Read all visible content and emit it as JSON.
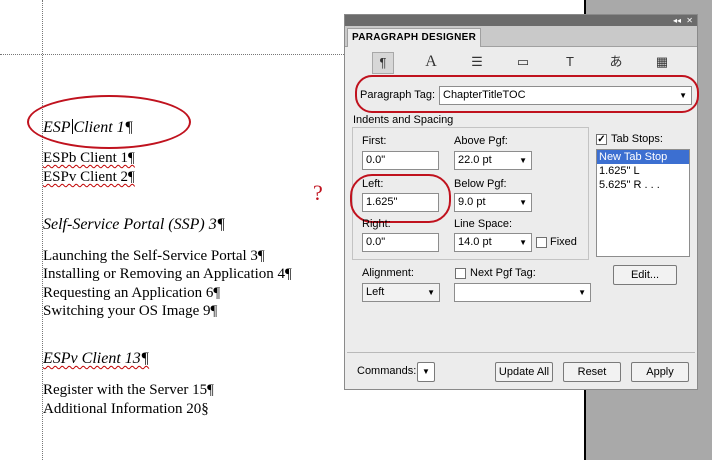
{
  "document": {
    "lines": [
      {
        "type": "heading",
        "parts": [
          "ESP",
          "Client 1¶"
        ]
      },
      {
        "type": "body",
        "text": "ESPb Client 1¶"
      },
      {
        "type": "body",
        "text": "ESPv Client 2¶"
      },
      {
        "type": "heading",
        "text": "Self-Service Portal (SSP) 3¶"
      },
      {
        "type": "body",
        "text": "Launching the Self-Service Portal 3¶"
      },
      {
        "type": "body",
        "text": "Installing or Removing an Application 4¶"
      },
      {
        "type": "body",
        "text": "Requesting an Application 6¶"
      },
      {
        "type": "body",
        "text": "Switching your OS Image 9¶"
      },
      {
        "type": "heading",
        "text": "ESPv Client 13¶"
      },
      {
        "type": "body",
        "text": "Register with the Server 15¶"
      },
      {
        "type": "body",
        "text": "Additional Information 20§"
      }
    ],
    "annotation": "?"
  },
  "panel": {
    "title": "PARAGRAPH DESIGNER",
    "titlebar_buttons": [
      "◂◂",
      "✕"
    ],
    "icons": [
      "paragraph-icon",
      "font-icon",
      "pagination-icon",
      "numbering-icon",
      "advanced-icon",
      "asian-icon",
      "table-cell-icon"
    ],
    "icon_glyphs": [
      "¶",
      "A",
      "☰",
      "▭",
      "T",
      "あ",
      "▦"
    ],
    "paragraph_tag_label": "Paragraph Tag:",
    "paragraph_tag_value": "ChapterTitleTOC",
    "section_label": "Indents and Spacing",
    "first_label": "First:",
    "first_value": "0.0\"",
    "left_label": "Left:",
    "left_value": "1.625\"",
    "right_label": "Right:",
    "right_value": "0.0\"",
    "above_label": "Above Pgf:",
    "above_value": "22.0 pt",
    "below_label": "Below Pgf:",
    "below_value": "9.0 pt",
    "linespace_label": "Line Space:",
    "linespace_value": "14.0 pt",
    "fixed_label": "Fixed",
    "fixed_checked": false,
    "tabstops_label": "Tab Stops:",
    "tabstops_checked": true,
    "tabstops": [
      "New Tab Stop",
      "1.625\"  L",
      "5.625\"  R  . . ."
    ],
    "edit_button": "Edit...",
    "alignment_label": "Alignment:",
    "alignment_value": "Left",
    "next_tag_label": "Next Pgf Tag:",
    "next_tag_checked": false,
    "next_tag_value": "",
    "commands_label": "Commands:",
    "update_all_button": "Update All",
    "reset_button": "Reset",
    "apply_button": "Apply"
  },
  "colors": {
    "annotation_red": "#c0121e",
    "selection_blue": "#3c6fd1",
    "panel_bg": "#ececec"
  }
}
